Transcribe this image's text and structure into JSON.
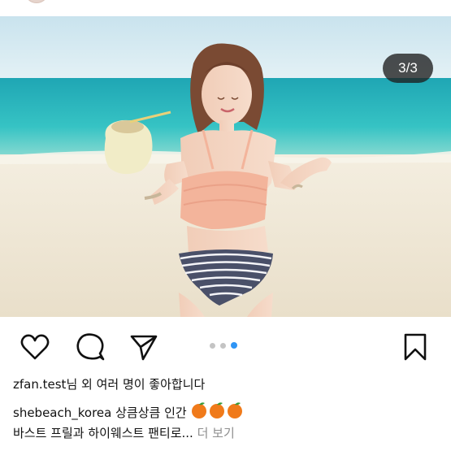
{
  "post": {
    "counter": "3/3",
    "likes_user": "zfan.test",
    "likes_text": "님 외 여러 명이 좋아합니다",
    "caption_user": "shebeach_korea",
    "caption_text": " 상큼상큼 인간 ",
    "caption_emojis": [
      "tangerine-emoji",
      "tangerine-emoji",
      "tangerine-emoji"
    ],
    "caption_line2": "바스트 프릴과 하이웨스트 팬티로...",
    "more_label": " 더 보기"
  },
  "carousel": {
    "total": 3,
    "active": 3
  },
  "icons": {
    "like": "heart-icon",
    "comment": "comment-icon",
    "share": "send-icon",
    "save": "bookmark-icon"
  },
  "colors": {
    "active_dot": "#2f95f5",
    "inactive_dot": "#c4c4c4",
    "muted_text": "#8e8e8e"
  }
}
